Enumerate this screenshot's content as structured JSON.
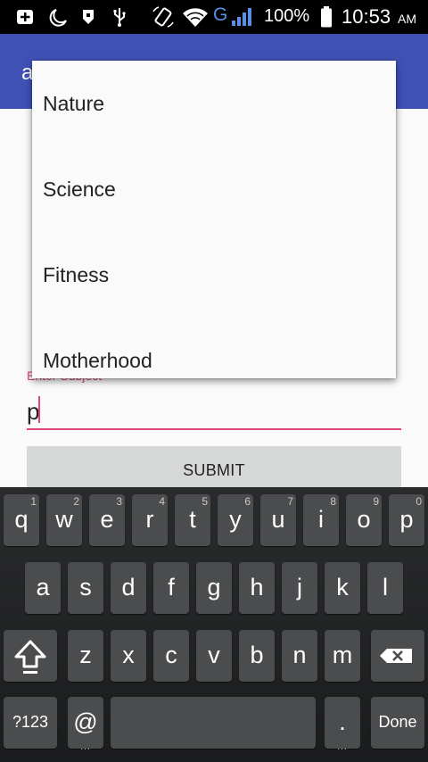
{
  "status_bar": {
    "network_type": "G",
    "battery_percent": "100%",
    "time": "10:53",
    "time_suffix": "AM",
    "icons": [
      "notification-add-icon",
      "night-mode-icon",
      "pocket-icon",
      "usb-icon",
      "rotation-icon",
      "wifi-icon",
      "signal-icon",
      "battery-icon"
    ]
  },
  "app_bar": {
    "title": "a"
  },
  "form": {
    "subject_label": "Enter Subject",
    "subject_value": "p",
    "submit_label": "SUBMIT"
  },
  "suggestions": [
    "Nature",
    "Science",
    "Fitness",
    "Motherhood"
  ],
  "keyboard": {
    "row1": [
      {
        "key": "q",
        "hint": "1"
      },
      {
        "key": "w",
        "hint": "2"
      },
      {
        "key": "e",
        "hint": "3"
      },
      {
        "key": "r",
        "hint": "4"
      },
      {
        "key": "t",
        "hint": "5"
      },
      {
        "key": "y",
        "hint": "6"
      },
      {
        "key": "u",
        "hint": "7"
      },
      {
        "key": "i",
        "hint": "8"
      },
      {
        "key": "o",
        "hint": "9"
      },
      {
        "key": "p",
        "hint": "0"
      }
    ],
    "row2": [
      "a",
      "s",
      "d",
      "f",
      "g",
      "h",
      "j",
      "k",
      "l"
    ],
    "row3": [
      "z",
      "x",
      "c",
      "v",
      "b",
      "n",
      "m"
    ],
    "symbols_label": "?123",
    "at_label": "@",
    "period_label": ".",
    "done_label": "Done"
  },
  "colors": {
    "status_bar": "#000000",
    "app_bar": "#3f51b5",
    "accent": "#e0457b",
    "button": "#d6d7d7",
    "key": "#4b4c4e",
    "keyboard_bg": "#222324"
  }
}
